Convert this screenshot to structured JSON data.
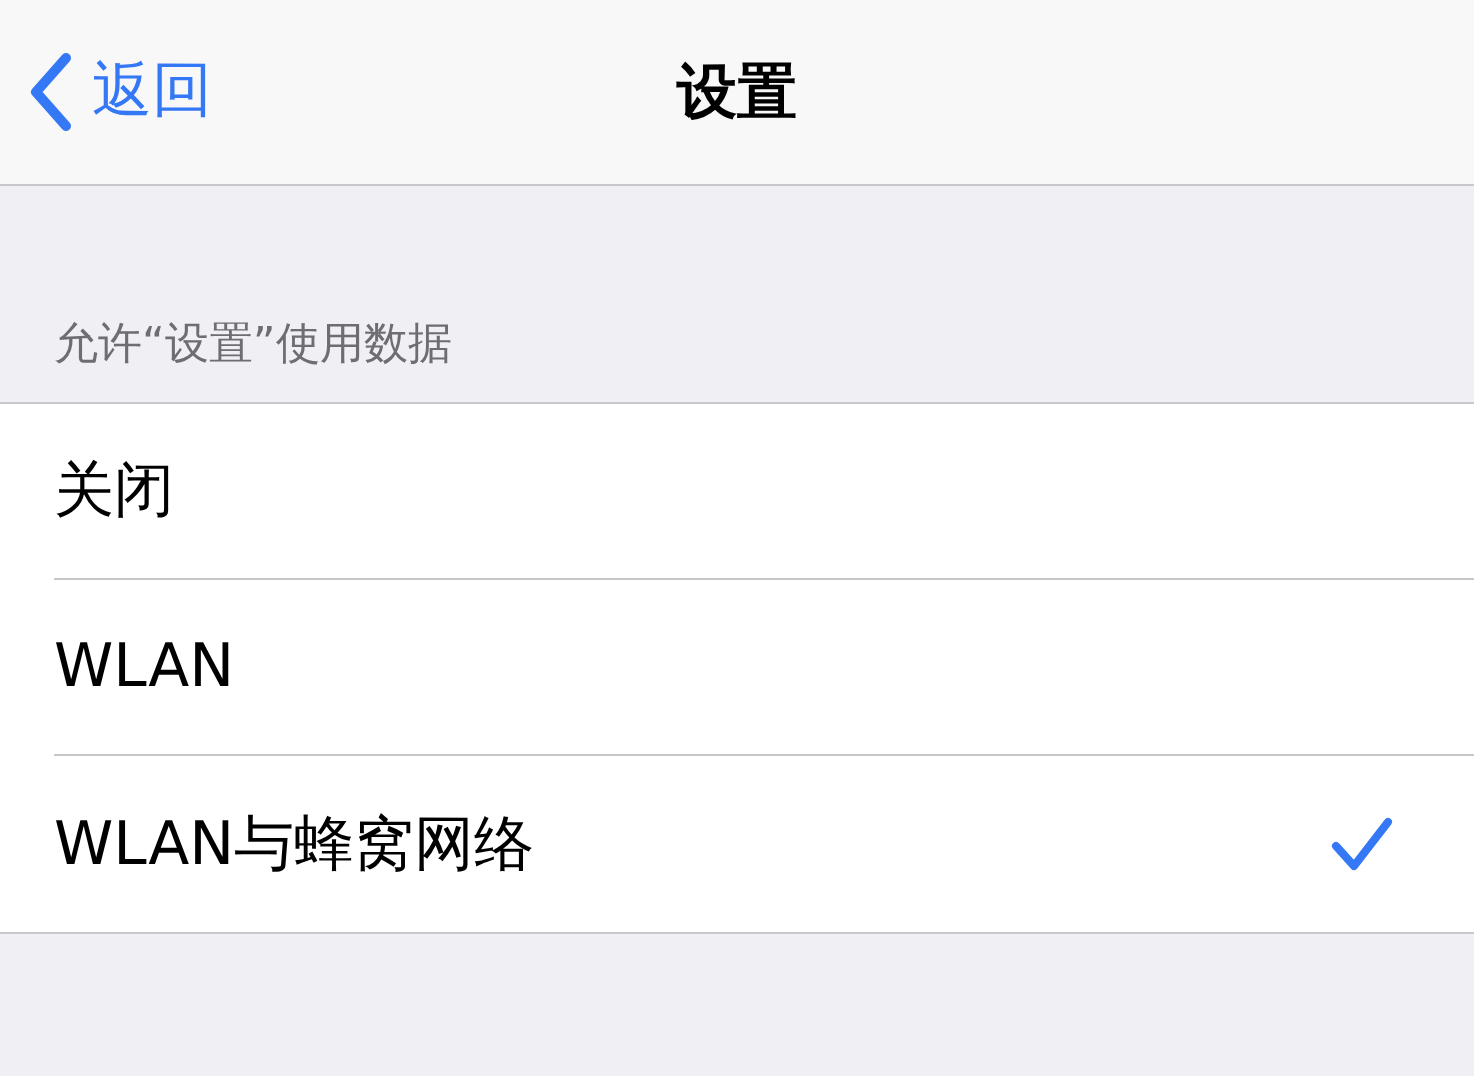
{
  "nav_bar": {
    "back_label": "返回",
    "title": "设置"
  },
  "section": {
    "header": "允许“设置”使用数据",
    "options": [
      {
        "label": "关闭",
        "selected": false
      },
      {
        "label": "WLAN",
        "selected": false
      },
      {
        "label": "WLAN与蜂窝网络",
        "selected": true
      }
    ]
  }
}
